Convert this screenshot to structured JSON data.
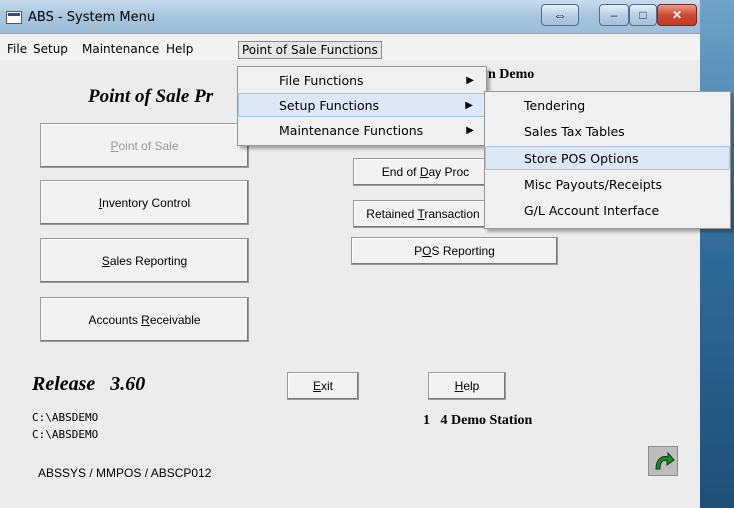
{
  "window": {
    "title": "ABS - System Menu",
    "resize_glyph": "⇔",
    "minimize_glyph": "–",
    "maximize_glyph": "□",
    "close_glyph": "✕"
  },
  "menubar": {
    "items": [
      "File",
      "Setup",
      "Maintenance",
      "Help",
      "Point of Sale Functions"
    ]
  },
  "content": {
    "heading": "Point of Sale Pr",
    "demo_label": "n Demo",
    "release": "Release   3.60",
    "path1": "C:\\ABSDEMO",
    "path2": "C:\\ABSDEMO",
    "station": "1   4 Demo Station",
    "footer_path": "ABSSYS / MMPOS / ABSCP012"
  },
  "left_buttons": [
    {
      "pre": "",
      "ul": "P",
      "post": "oint of Sale",
      "disabled": true
    },
    {
      "pre": "",
      "ul": "I",
      "post": "nventory Control",
      "disabled": false
    },
    {
      "pre": "",
      "ul": "S",
      "post": "ales Reporting",
      "disabled": false
    },
    {
      "pre": "Accounts ",
      "ul": "R",
      "post": "eceivable",
      "disabled": false
    }
  ],
  "center_buttons": {
    "end_of_day": {
      "pre": "End of ",
      "ul": "D",
      "post": "ay Proc"
    },
    "retained": {
      "pre": "Retained ",
      "ul": "T",
      "post": "ransaction"
    },
    "pos_reporting": {
      "pre": "P",
      "ul": "O",
      "post": "S Reporting"
    },
    "exit": {
      "pre": "",
      "ul": "E",
      "post": "xit"
    },
    "help": {
      "pre": "",
      "ul": "H",
      "post": "elp"
    }
  },
  "pos_menu": {
    "items": [
      "File Functions",
      "Setup Functions",
      "Maintenance Functions"
    ],
    "arrow": "▶"
  },
  "setup_submenu": {
    "items": [
      "Tendering",
      "Sales Tax Tables",
      "Store POS Options",
      "Misc Payouts/Receipts",
      "G/L Account Interface"
    ],
    "highlighted": "Store POS Options"
  },
  "icons": {
    "refresh": "refresh-icon"
  },
  "colors": {
    "refresh_green": "#1e8a2a",
    "highlight": "#dce8f7"
  }
}
